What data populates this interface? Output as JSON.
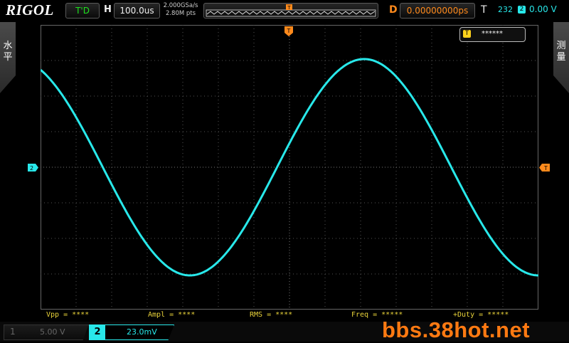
{
  "topbar": {
    "logo": "RIGOL",
    "run_state": "T'D",
    "h_label": "H",
    "timebase": "100.0us",
    "sample_rate": "2.000GSa/s",
    "mem_depth": "2.80M pts",
    "memory_trigger_marker": "T",
    "delay_label": "D",
    "delay_value": "0.00000000ps",
    "trig_label": "T",
    "trig_count": "232",
    "trig_channel": "2",
    "trig_level": "0.00 V"
  },
  "left_tab": {
    "label": "水平"
  },
  "right_tab": {
    "label": "测量"
  },
  "trigger_box": {
    "icon": "T",
    "value": "******"
  },
  "markers": {
    "ch2_ground": "2",
    "trigger_top": "T",
    "trigger_level": "T"
  },
  "measurements": [
    {
      "label": "Vpp = ****"
    },
    {
      "label": "Ampl = ****"
    },
    {
      "label": "RMS = ****"
    },
    {
      "label": "Freq = *****"
    },
    {
      "label": "+Duty = *****"
    }
  ],
  "channels": {
    "ch1": {
      "num": "1",
      "scale": "5.00 V"
    },
    "ch2": {
      "num": "2",
      "scale": "23.0mV"
    }
  },
  "watermark": "bbs.38hot.net",
  "colors": {
    "ch2_trace": "#28e8ea",
    "trigger": "#ff8a1c",
    "measure_text": "#e8d23a",
    "grid": "#555555"
  }
}
